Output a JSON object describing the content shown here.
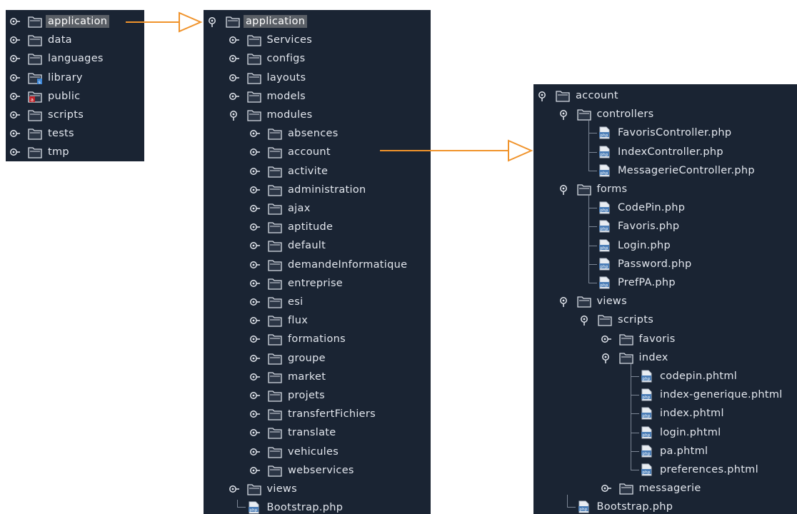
{
  "panel1": {
    "items": [
      {
        "label": "application",
        "icon": "folder-icon",
        "selected": true
      },
      {
        "label": "data",
        "icon": "folder-icon"
      },
      {
        "label": "languages",
        "icon": "folder-icon"
      },
      {
        "label": "library",
        "icon": "folder-library-icon"
      },
      {
        "label": "public",
        "icon": "folder-public-icon"
      },
      {
        "label": "scripts",
        "icon": "folder-icon"
      },
      {
        "label": "tests",
        "icon": "folder-icon"
      },
      {
        "label": "tmp",
        "icon": "folder-icon"
      }
    ]
  },
  "panel2": {
    "root": "application",
    "children": [
      "Services",
      "configs",
      "layouts",
      "models"
    ],
    "modules_label": "modules",
    "modules": [
      "absences",
      "account",
      "activite",
      "administration",
      "ajax",
      "aptitude",
      "default",
      "demandeInformatique",
      "entreprise",
      "esi",
      "flux",
      "formations",
      "groupe",
      "market",
      "projets",
      "transfertFichiers",
      "translate",
      "vehicules",
      "webservices"
    ],
    "views_label": "views",
    "bootstrap_file": "Bootstrap.php"
  },
  "panel3": {
    "root": "account",
    "controllers_label": "controllers",
    "controllers": [
      "FavorisController.php",
      "IndexController.php",
      "MessagerieController.php"
    ],
    "forms_label": "forms",
    "forms": [
      "CodePin.php",
      "Favoris.php",
      "Login.php",
      "Password.php",
      "PrefPA.php"
    ],
    "views_label": "views",
    "scripts_label": "scripts",
    "favoris_label": "favoris",
    "index_label": "index",
    "index_files": [
      "codepin.phtml",
      "index-generique.phtml",
      "index.phtml",
      "login.phtml",
      "pa.phtml",
      "preferences.phtml"
    ],
    "messagerie_label": "messagerie",
    "bootstrap_file": "Bootstrap.php"
  },
  "colors": {
    "panel_bg": "#1a2433",
    "text": "#e3e7ee",
    "selection": "#5a5f66",
    "arrow": "#f0932b"
  }
}
